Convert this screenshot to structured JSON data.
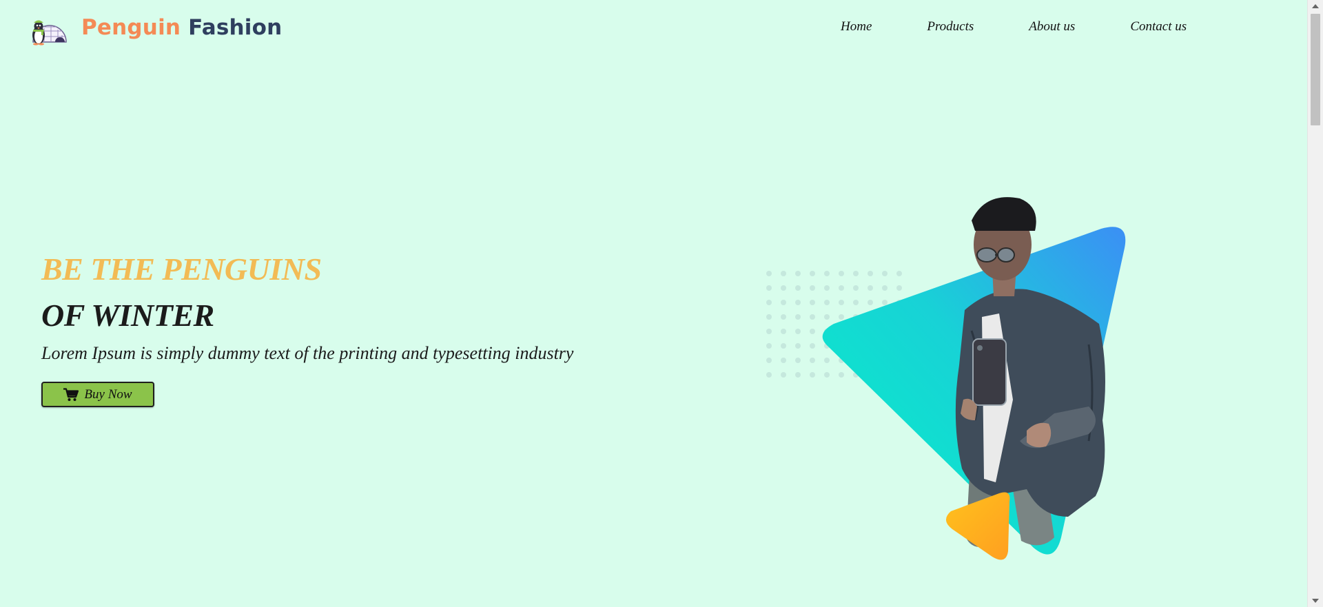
{
  "brand": {
    "name_part1": "Penguin",
    "name_part2": "Fashion",
    "logo_icon": "penguin-igloo-logo-icon"
  },
  "nav": {
    "items": [
      {
        "label": "Home"
      },
      {
        "label": "Products"
      },
      {
        "label": "About us"
      },
      {
        "label": "Contact us"
      }
    ]
  },
  "hero": {
    "headline_line1": "BE THE PENGUINS",
    "headline_line2": "OF WINTER",
    "subtitle": "Lorem Ipsum is simply dummy text of the printing and typesetting industry",
    "cta_label": "Buy Now",
    "cta_icon": "cart-icon"
  },
  "colors": {
    "background": "#d8fdec",
    "brand_orange": "#f48a55",
    "brand_navy": "#2f3f5f",
    "headline_accent": "#f2bb55",
    "button_green": "#8bc34a",
    "triangle_gradient_start": "#05f2c7",
    "triangle_gradient_end": "#3b8ff5",
    "small_triangle": "#ffb020"
  }
}
